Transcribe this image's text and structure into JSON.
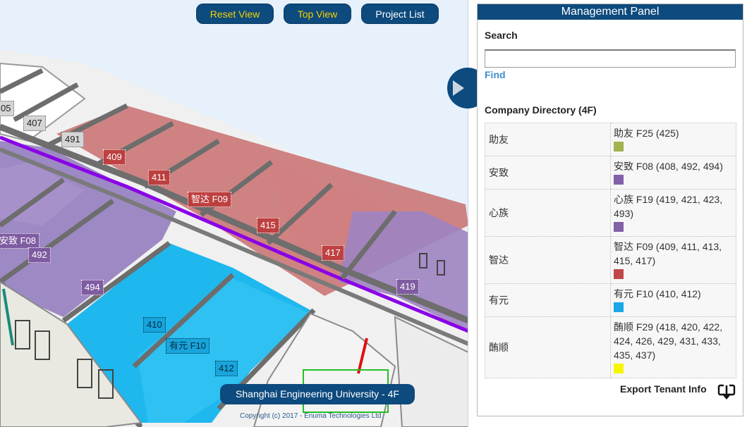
{
  "toolbar": {
    "reset_view": "Reset View",
    "top_view": "Top View",
    "project_list": "Project List"
  },
  "floor_plan": {
    "building_caption": "Shanghai Engineering University - 4F",
    "copyright": "Copyright (c) 2017 - Enuma Technologies Ltd",
    "labels": {
      "r405": "05",
      "r407": "407",
      "r491": "491",
      "r409": "409",
      "r411": "411",
      "zhida": "智达 F09",
      "r415": "415",
      "r417": "417",
      "anzhi": "安致 F08",
      "r492": "492",
      "r494": "494",
      "r419": "419",
      "r410": "410",
      "youyuan": "有元 F10",
      "r412": "412"
    }
  },
  "panel": {
    "title": "Management Panel",
    "search_label": "Search",
    "search_value": "",
    "search_placeholder": "",
    "find_label": "Find",
    "directory_title": "Company Directory (4F)",
    "companies": [
      {
        "name": "助友",
        "line1": "助友 F25 (425)",
        "line2": "",
        "color": "#a0b350"
      },
      {
        "name": "安致",
        "line1": "安致 F08 (408, 492, 494)",
        "line2": "",
        "color": "#8261a8"
      },
      {
        "name": "心族",
        "line1": "心族 F19 (419, 421, 423,",
        "line2": "493)",
        "color": "#8261a8"
      },
      {
        "name": "智达",
        "line1": "智达 F09 (409, 411, 413,",
        "line2": "415, 417)",
        "color": "#c04848"
      },
      {
        "name": "有元",
        "line1": "有元 F10 (410, 412)",
        "line2": "",
        "color": "#1aa7e8"
      },
      {
        "name": "酭顺",
        "line1": "酭顺 F29 (418, 420, 422,",
        "line2": "424, 426, 429, 431, 433,",
        "line3": "435, 437)",
        "color": "#f6f600"
      }
    ],
    "export_label": "Export Tenant Info"
  },
  "icons": {
    "collapse": "chevron-right-icon",
    "export": "download-icon"
  }
}
